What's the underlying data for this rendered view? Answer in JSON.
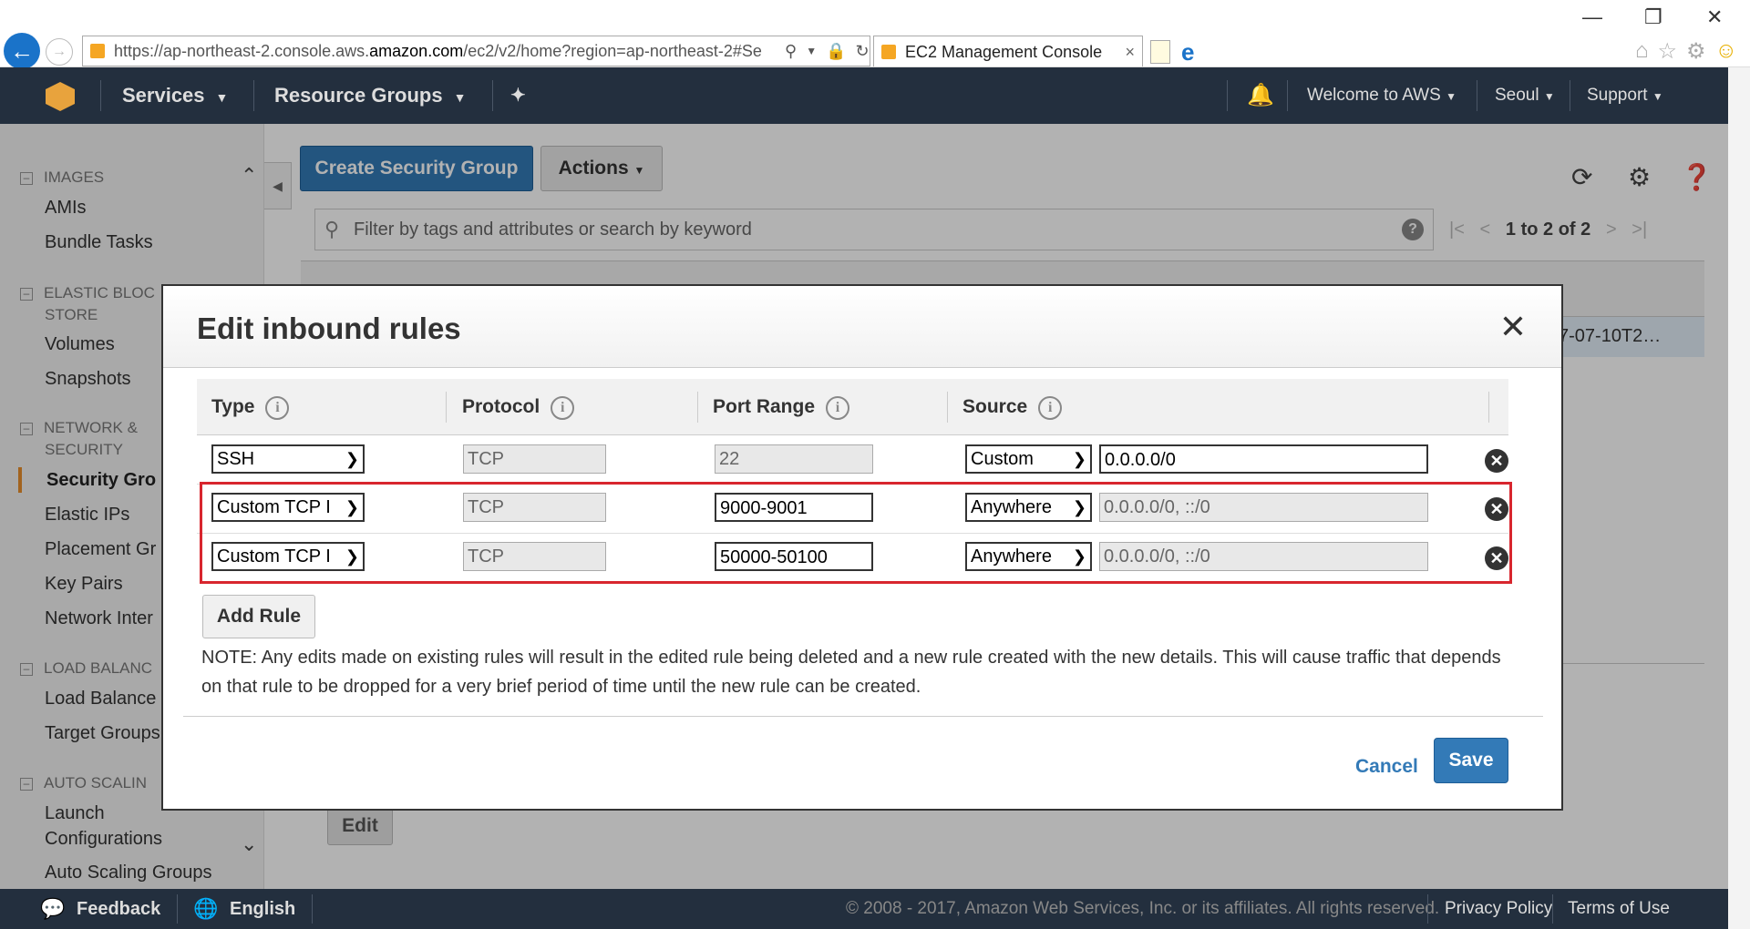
{
  "browser": {
    "url_prefix": "https://ap-northeast-2.console.aws.",
    "url_domain": "amazon.com",
    "url_suffix": "/ec2/v2/home?region=ap-northeast-2#Se",
    "tab_title": "EC2 Management Console",
    "tab_close": "×"
  },
  "aws_header": {
    "services": "Services",
    "resource_groups": "Resource Groups",
    "welcome": "Welcome to AWS",
    "region": "Seoul",
    "support": "Support"
  },
  "sidebar": {
    "sections": [
      {
        "title": "IMAGES",
        "items": [
          "AMIs",
          "Bundle Tasks"
        ]
      },
      {
        "title_line1": "ELASTIC BLOC",
        "title_line2": "STORE",
        "items": [
          "Volumes",
          "Snapshots"
        ]
      },
      {
        "title_line1": "NETWORK &",
        "title_line2": "SECURITY",
        "items": [
          "Security Gro",
          "Elastic IPs",
          "Placement Gr",
          "Key Pairs",
          "Network Inter"
        ]
      },
      {
        "title": "LOAD BALANC",
        "items": [
          "Load Balance",
          "Target Groups"
        ]
      },
      {
        "title": "AUTO SCALIN",
        "items": [
          "Launch",
          "Configurations",
          "Auto Scaling Groups"
        ]
      }
    ],
    "active_item": "Security Gro"
  },
  "toolbar": {
    "create_button": "Create Security Group",
    "actions_button": "Actions"
  },
  "filter": {
    "placeholder": "Filter by tags and attributes or search by keyword"
  },
  "pager": {
    "text": "1 to 2 of 2"
  },
  "table": {
    "visible_cell": "7-07-10T2…"
  },
  "lower": {
    "edit_button": "Edit"
  },
  "modal": {
    "title": "Edit inbound rules",
    "columns": [
      "Type",
      "Protocol",
      "Port Range",
      "Source"
    ],
    "rules": [
      {
        "type": "SSH",
        "protocol": "TCP",
        "port_range": "22",
        "source_type": "Custom",
        "source_value": "0.0.0.0/0"
      },
      {
        "type": "Custom TCP I",
        "protocol": "TCP",
        "port_range": "9000-9001",
        "source_type": "Anywhere",
        "source_value": "0.0.0.0/0, ::/0"
      },
      {
        "type": "Custom TCP I",
        "protocol": "TCP",
        "port_range": "50000-50100",
        "source_type": "Anywhere",
        "source_value": "0.0.0.0/0, ::/0"
      }
    ],
    "add_rule_button": "Add Rule",
    "note": "NOTE: Any edits made on existing rules will result in the edited rule being deleted and a new rule created with the new details. This will cause traffic that depends on that rule to be dropped for a very brief period of time until the new rule can be created.",
    "cancel_button": "Cancel",
    "save_button": "Save",
    "highlight_color": "#d8262e"
  },
  "footer": {
    "feedback": "Feedback",
    "language": "English",
    "copyright": "© 2008 - 2017, Amazon Web Services, Inc. or its affiliates. All rights reserved.",
    "privacy": "Privacy Policy",
    "terms": "Terms of Use"
  },
  "colors": {
    "aws_dark": "#232f3e",
    "primary_blue": "#337ab7",
    "aws_orange": "#e88e2b"
  }
}
